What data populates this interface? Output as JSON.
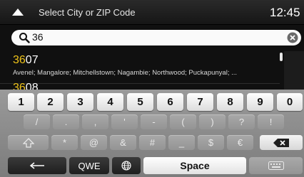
{
  "header": {
    "title": "Select City or ZIP Code",
    "time": "12:45",
    "back_icon": "navigation-arrow-icon"
  },
  "search": {
    "value": "36",
    "search_icon": "search-icon",
    "clear_icon": "clear-icon"
  },
  "results": [
    {
      "highlight": "36",
      "rest": "07",
      "subtitle": "Avenel; Mangalore; Mitchellstown; Nagambie; Northwood; Puckapunyal; ..."
    },
    {
      "highlight": "36",
      "rest": "08",
      "subtitle": ""
    }
  ],
  "keyboard": {
    "row1": [
      "1",
      "2",
      "3",
      "4",
      "5",
      "6",
      "7",
      "8",
      "9",
      "0"
    ],
    "row2": [
      "/",
      ".",
      ",",
      "'",
      "-",
      "(",
      ")",
      "?",
      "!"
    ],
    "row3": [
      "*",
      "@",
      "&",
      "#",
      "_",
      "$",
      "€"
    ],
    "shift_icon": "shift-icon",
    "backspace_icon": "backspace-icon",
    "enter_icon": "enter-arrow-icon",
    "layout_label": "QWE",
    "globe_icon": "globe-icon",
    "space_label": "Space",
    "hide_keyboard_icon": "keyboard-hide-icon"
  },
  "colors": {
    "highlight": "#f0c419",
    "header_bg": "#1e1e1e",
    "keyboard_bg": "#8a8a8a"
  }
}
